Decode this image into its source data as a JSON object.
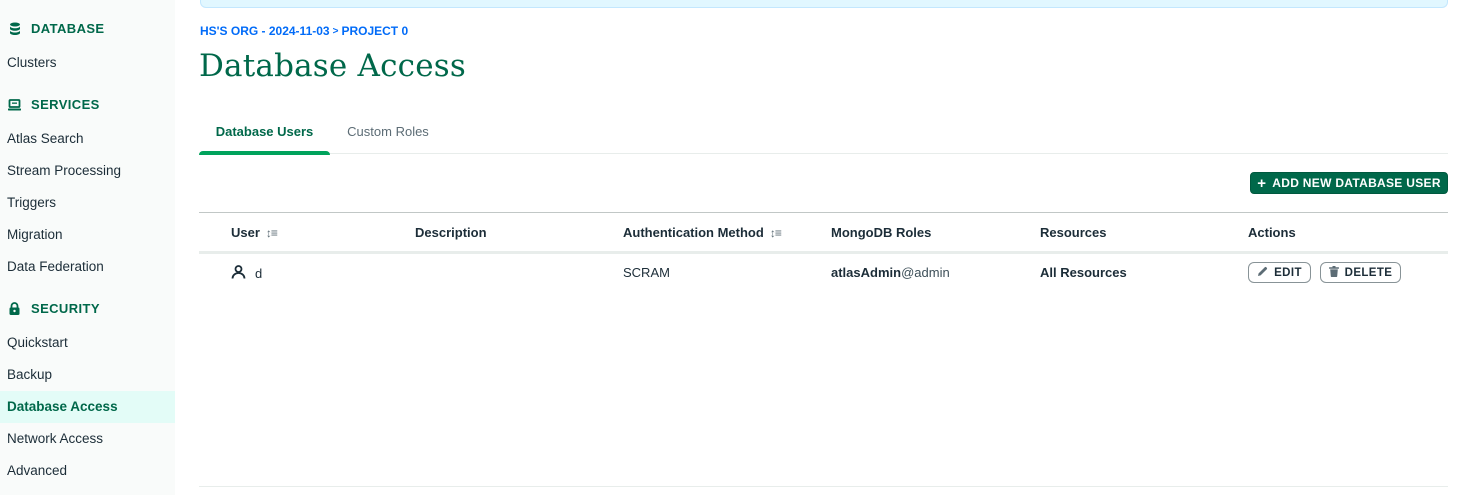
{
  "sidebar": {
    "sections": [
      {
        "label": "DATABASE",
        "icon": "database-icon",
        "items": [
          {
            "label": "Clusters"
          }
        ]
      },
      {
        "label": "SERVICES",
        "icon": "laptop-icon",
        "items": [
          {
            "label": "Atlas Search"
          },
          {
            "label": "Stream Processing"
          },
          {
            "label": "Triggers"
          },
          {
            "label": "Migration"
          },
          {
            "label": "Data Federation"
          }
        ]
      },
      {
        "label": "SECURITY",
        "icon": "lock-icon",
        "items": [
          {
            "label": "Quickstart"
          },
          {
            "label": "Backup"
          },
          {
            "label": "Database Access",
            "active": true
          },
          {
            "label": "Network Access"
          },
          {
            "label": "Advanced"
          }
        ]
      }
    ]
  },
  "breadcrumb": {
    "org": "HS'S ORG - 2024-11-03",
    "separator": ">",
    "project": "PROJECT 0"
  },
  "page_title": "Database Access",
  "tabs": [
    {
      "label": "Database Users",
      "active": true
    },
    {
      "label": "Custom Roles",
      "active": false
    }
  ],
  "add_user_button": {
    "icon": "plus-icon",
    "label": "ADD NEW DATABASE USER"
  },
  "table": {
    "columns": [
      "User",
      "Description",
      "Authentication Method",
      "MongoDB Roles",
      "Resources",
      "Actions"
    ],
    "rows": [
      {
        "user": "d",
        "description": "",
        "auth_method": "SCRAM",
        "role_name": "atlasAdmin",
        "role_db": "@admin",
        "resources": "All Resources",
        "edit_label": "EDIT",
        "delete_label": "DELETE"
      }
    ]
  },
  "colors": {
    "brand": "#00684a",
    "accent": "#00a35c",
    "link": "#016bf8",
    "active_bg": "#e3fcf7"
  }
}
